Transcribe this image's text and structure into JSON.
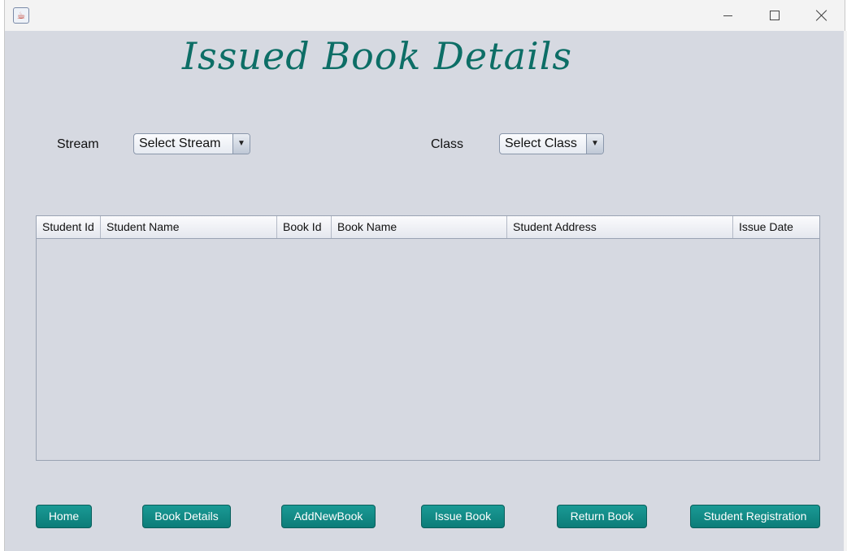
{
  "window": {
    "icon": "java-icon"
  },
  "heading": "Issued Book Details",
  "filters": {
    "stream_label": "Stream",
    "stream_value": "Select Stream",
    "class_label": "Class",
    "class_value": "Select Class"
  },
  "table": {
    "columns": [
      "Student Id",
      "Student Name",
      "Book Id",
      "Book Name",
      "Student Address",
      "Issue Date"
    ],
    "rows": []
  },
  "nav": {
    "home": "Home",
    "book_details": "Book Details",
    "add_new_book": "AddNewBook",
    "issue_book": "Issue Book",
    "return_book": "Return Book",
    "student_registration": "Student Registration"
  },
  "colors": {
    "accent": "#0d6e66",
    "button": "#128a86",
    "background": "#d6d9e1"
  }
}
